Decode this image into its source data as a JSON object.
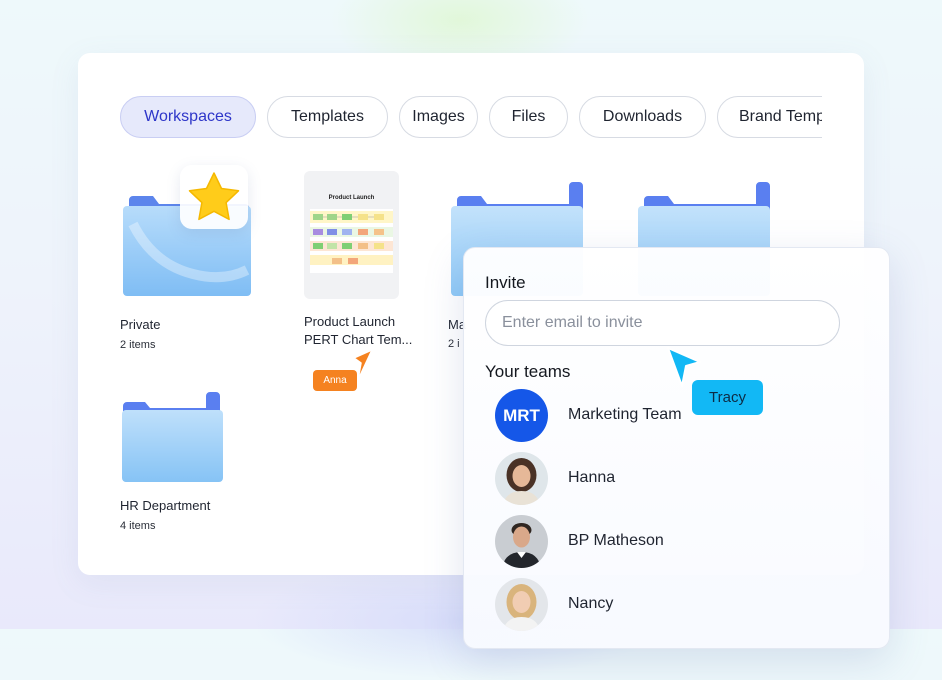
{
  "tabs": [
    {
      "label": "Workspaces",
      "active": true
    },
    {
      "label": "Templates",
      "active": false
    },
    {
      "label": "Images",
      "active": false
    },
    {
      "label": "Files",
      "active": false
    },
    {
      "label": "Downloads",
      "active": false
    },
    {
      "label": "Brand Templates",
      "active": false
    }
  ],
  "items": {
    "private": {
      "name": "Private",
      "count": "2 items"
    },
    "template": {
      "name_line1": "Product Launch",
      "name_line2": "PERT Chart Tem...",
      "thumb_title": "Product Launch"
    },
    "third": {
      "name_partial": "Ma",
      "count_partial": "2 i"
    },
    "hr": {
      "name": "HR Department",
      "count": "4 items"
    }
  },
  "collaborators": {
    "anna": {
      "label": "Anna",
      "color": "#f58220"
    },
    "tracy": {
      "label": "Tracy",
      "color": "#12b8f5"
    }
  },
  "invite_panel": {
    "title": "Invite",
    "input_placeholder": "Enter email to invite",
    "input_value": "",
    "teams_title": "Your teams",
    "teams": [
      {
        "name": "Marketing Team",
        "avatar_text": "MRT",
        "avatar": "initials"
      },
      {
        "name": "Hanna",
        "avatar": "photo-woman-curly-hair"
      },
      {
        "name": "BP Matheson",
        "avatar": "photo-man-suit"
      },
      {
        "name": "Nancy",
        "avatar": "photo-woman-blonde"
      }
    ]
  },
  "icons": {
    "favorite": "star-icon",
    "folder": "folder-icon",
    "cursor": "pointer-cursor-icon"
  },
  "colors": {
    "active_tab_text": "#2e36c9",
    "active_tab_bg": "#e6e9fb",
    "star": "#ffcc1a",
    "folder_front": "#8ec9f7",
    "folder_back": "#5b86ee"
  }
}
